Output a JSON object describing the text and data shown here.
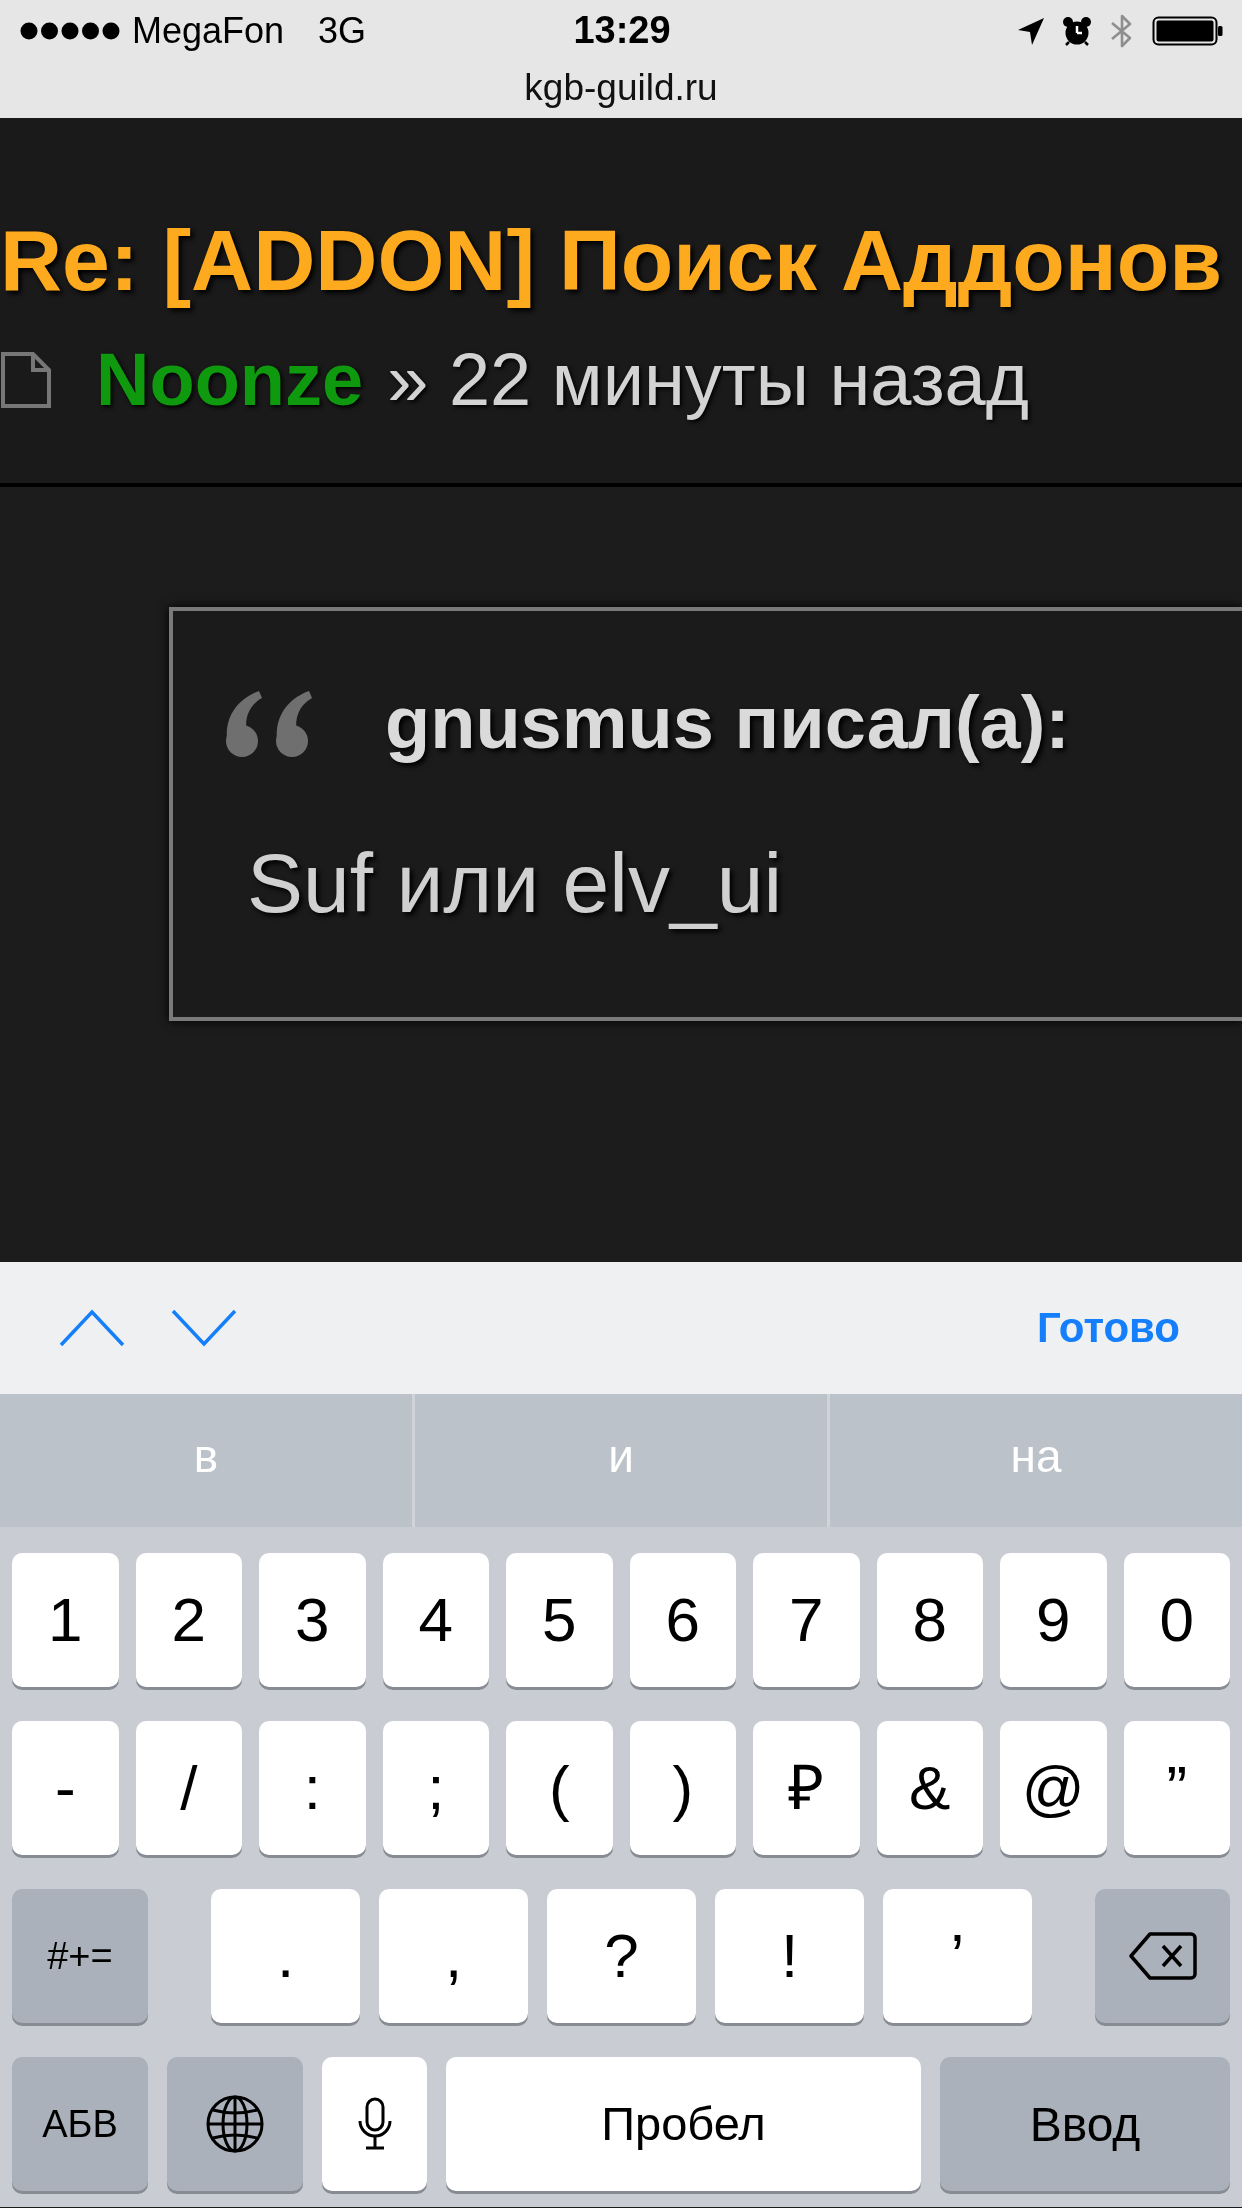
{
  "status_bar": {
    "carrier": "MegaFon",
    "network": "3G",
    "time": "13:29",
    "url": "kgb-guild.ru"
  },
  "post": {
    "title": "Re: [ADDON] Поиск Аддонов",
    "author": "Noonze",
    "time": "» 22 минуты назад",
    "quote": {
      "author": "gnusmus писал(а):",
      "text": "Suf или elv_ui"
    }
  },
  "keyboard_toolbar": {
    "done": "Готово"
  },
  "suggestions": [
    "в",
    "и",
    "на"
  ],
  "keyboard": {
    "rows": [
      {
        "keys": [
          {
            "kind": "char",
            "label": "1"
          },
          {
            "kind": "char",
            "label": "2"
          },
          {
            "kind": "char",
            "label": "3"
          },
          {
            "kind": "char",
            "label": "4"
          },
          {
            "kind": "char",
            "label": "5"
          },
          {
            "kind": "char",
            "label": "6"
          },
          {
            "kind": "char",
            "label": "7"
          },
          {
            "kind": "char",
            "label": "8"
          },
          {
            "kind": "char",
            "label": "9"
          },
          {
            "kind": "char",
            "label": "0"
          }
        ]
      },
      {
        "keys": [
          {
            "kind": "char",
            "label": "-"
          },
          {
            "kind": "char",
            "label": "/"
          },
          {
            "kind": "char",
            "label": ":"
          },
          {
            "kind": "char",
            "label": ";"
          },
          {
            "kind": "char",
            "label": "("
          },
          {
            "kind": "char",
            "label": ")"
          },
          {
            "kind": "char",
            "label": "₽"
          },
          {
            "kind": "char",
            "label": "&"
          },
          {
            "kind": "char",
            "label": "@"
          },
          {
            "kind": "char",
            "label": "”"
          }
        ]
      },
      {
        "keys": [
          {
            "kind": "mode",
            "label": "#+="
          },
          {
            "kind": "char",
            "label": "."
          },
          {
            "kind": "char",
            "label": ","
          },
          {
            "kind": "char",
            "label": "?"
          },
          {
            "kind": "char",
            "label": "!"
          },
          {
            "kind": "char",
            "label": "’"
          },
          {
            "kind": "delete"
          }
        ]
      },
      {
        "keys": [
          {
            "kind": "mode",
            "label": "АБВ"
          },
          {
            "kind": "globe"
          },
          {
            "kind": "mic"
          },
          {
            "kind": "space",
            "label": "Пробел"
          },
          {
            "kind": "return",
            "label": "Ввод"
          }
        ]
      }
    ]
  }
}
